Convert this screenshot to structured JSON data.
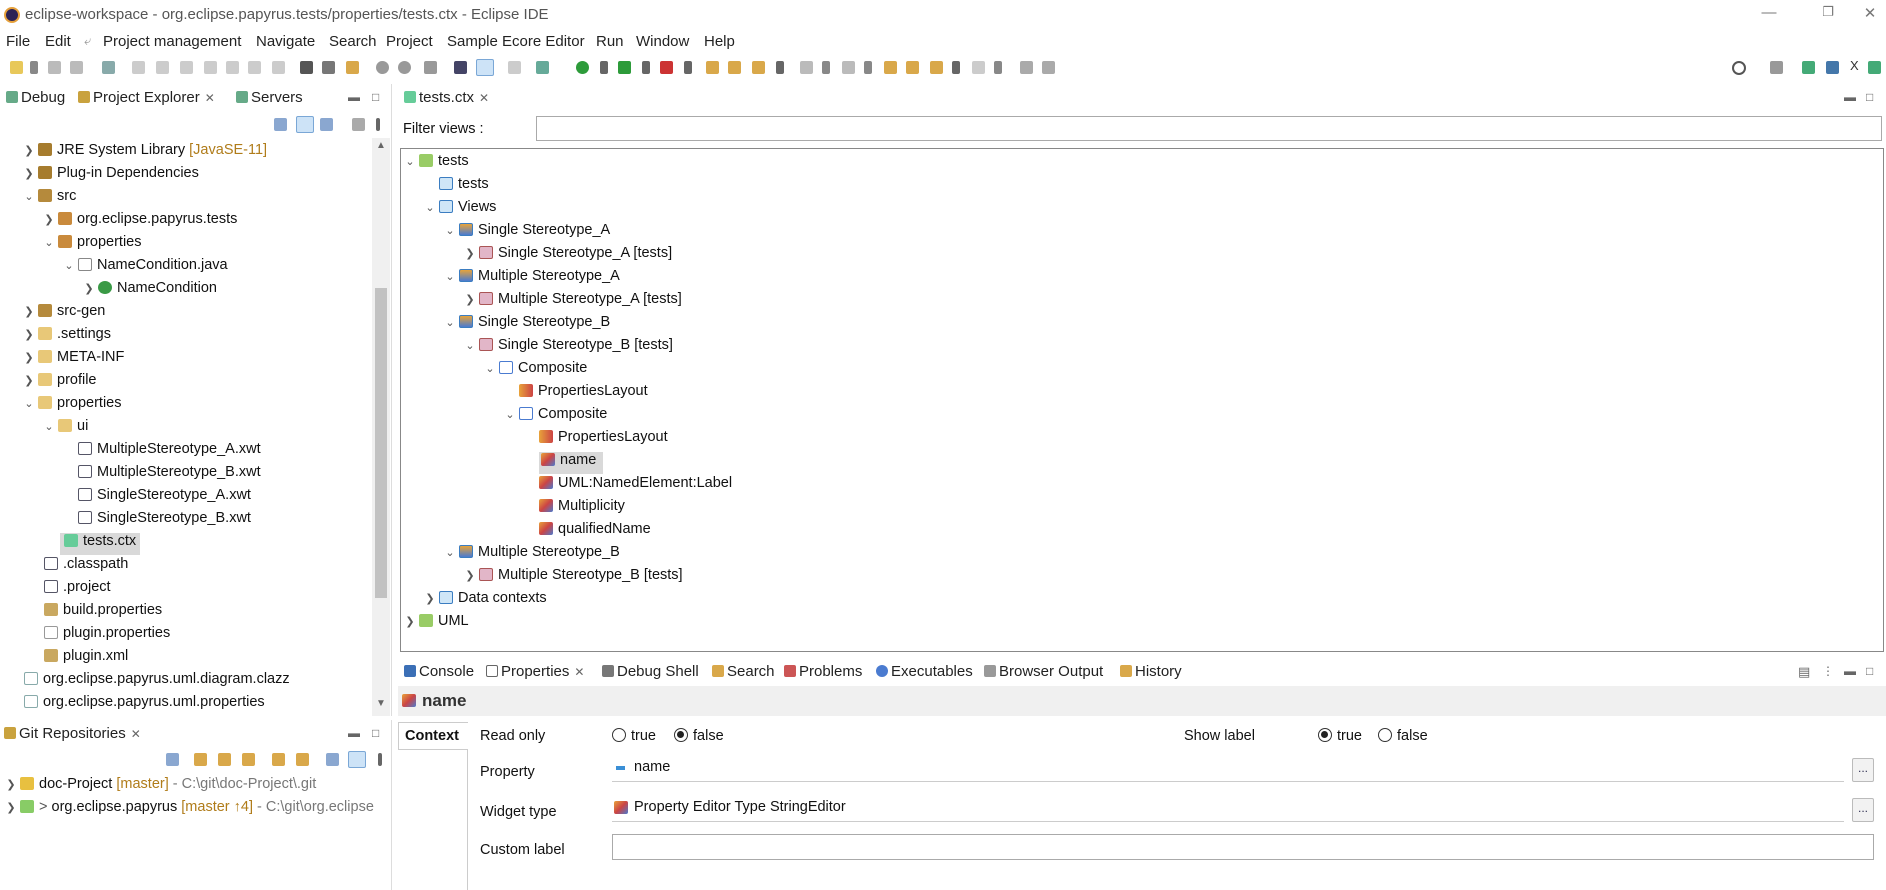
{
  "window": {
    "title": "eclipse-workspace - org.eclipse.papyrus.tests/properties/tests.ctx - Eclipse IDE"
  },
  "menu": [
    "File",
    "Edit",
    "Project management",
    "Navigate",
    "Search",
    "Project",
    "Sample Ecore Editor",
    "Run",
    "Window",
    "Help"
  ],
  "left_panel": {
    "tabs": [
      "Debug",
      "Project Explorer",
      "Servers"
    ],
    "tree": [
      {
        "label": "JRE System Library",
        "deco": "[JavaSE-11]"
      },
      {
        "label": "Plug-in Dependencies"
      },
      {
        "label": "src"
      },
      {
        "label": "org.eclipse.papyrus.tests"
      },
      {
        "label": "properties"
      },
      {
        "label": "NameCondition.java"
      },
      {
        "label": "NameCondition"
      },
      {
        "label": "src-gen"
      },
      {
        "label": ".settings"
      },
      {
        "label": "META-INF"
      },
      {
        "label": "profile"
      },
      {
        "label": "properties"
      },
      {
        "label": "ui"
      },
      {
        "label": "MultipleStereotype_A.xwt"
      },
      {
        "label": "MultipleStereotype_B.xwt"
      },
      {
        "label": "SingleStereotype_A.xwt"
      },
      {
        "label": "SingleStereotype_B.xwt"
      },
      {
        "label": "tests.ctx"
      },
      {
        "label": ".classpath"
      },
      {
        "label": ".project"
      },
      {
        "label": "build.properties"
      },
      {
        "label": "plugin.properties"
      },
      {
        "label": "plugin.xml"
      },
      {
        "label": "org.eclipse.papyrus.uml.diagram.clazz"
      },
      {
        "label": "org.eclipse.papyrus.uml.properties"
      }
    ]
  },
  "git_panel": {
    "tab": "Git Repositories",
    "repos": [
      {
        "prefix": "",
        "name": "doc-Project",
        "branch": "[master]",
        "path": "- C:\\git\\doc-Project\\.git"
      },
      {
        "prefix": ">",
        "name": "org.eclipse.papyrus",
        "branch": "[master ↑4]",
        "path": "- C:\\git\\org.eclipse"
      }
    ]
  },
  "editor": {
    "tab": "tests.ctx",
    "filter_label": "Filter views :",
    "filter_value": "",
    "tree": [
      {
        "label": "tests"
      },
      {
        "label": "tests"
      },
      {
        "label": "Views"
      },
      {
        "label": "Single Stereotype_A"
      },
      {
        "label": "Single Stereotype_A [tests]"
      },
      {
        "label": "Multiple Stereotype_A"
      },
      {
        "label": "Multiple Stereotype_A [tests]"
      },
      {
        "label": "Single Stereotype_B"
      },
      {
        "label": "Single Stereotype_B [tests]"
      },
      {
        "label": "Composite"
      },
      {
        "label": "PropertiesLayout"
      },
      {
        "label": "Composite"
      },
      {
        "label": "PropertiesLayout"
      },
      {
        "label": "name"
      },
      {
        "label": "UML:NamedElement:Label"
      },
      {
        "label": "Multiplicity"
      },
      {
        "label": "qualifiedName"
      },
      {
        "label": "Multiple Stereotype_B"
      },
      {
        "label": "Multiple Stereotype_B [tests]"
      },
      {
        "label": "Data contexts"
      },
      {
        "label": "UML"
      }
    ]
  },
  "bottom_panel": {
    "tabs": [
      "Console",
      "Properties",
      "Debug Shell",
      "Search",
      "Problems",
      "Executables",
      "Browser Output",
      "History"
    ],
    "header": "name",
    "section_tab": "Context",
    "read_only_label": "Read only",
    "true_label": "true",
    "false_label": "false",
    "show_label_label": "Show label",
    "property_label": "Property",
    "property_value": "name",
    "widget_type_label": "Widget type",
    "widget_type_value": "Property Editor Type StringEditor",
    "custom_label_label": "Custom label",
    "custom_label_value": "",
    "dots": "..."
  }
}
